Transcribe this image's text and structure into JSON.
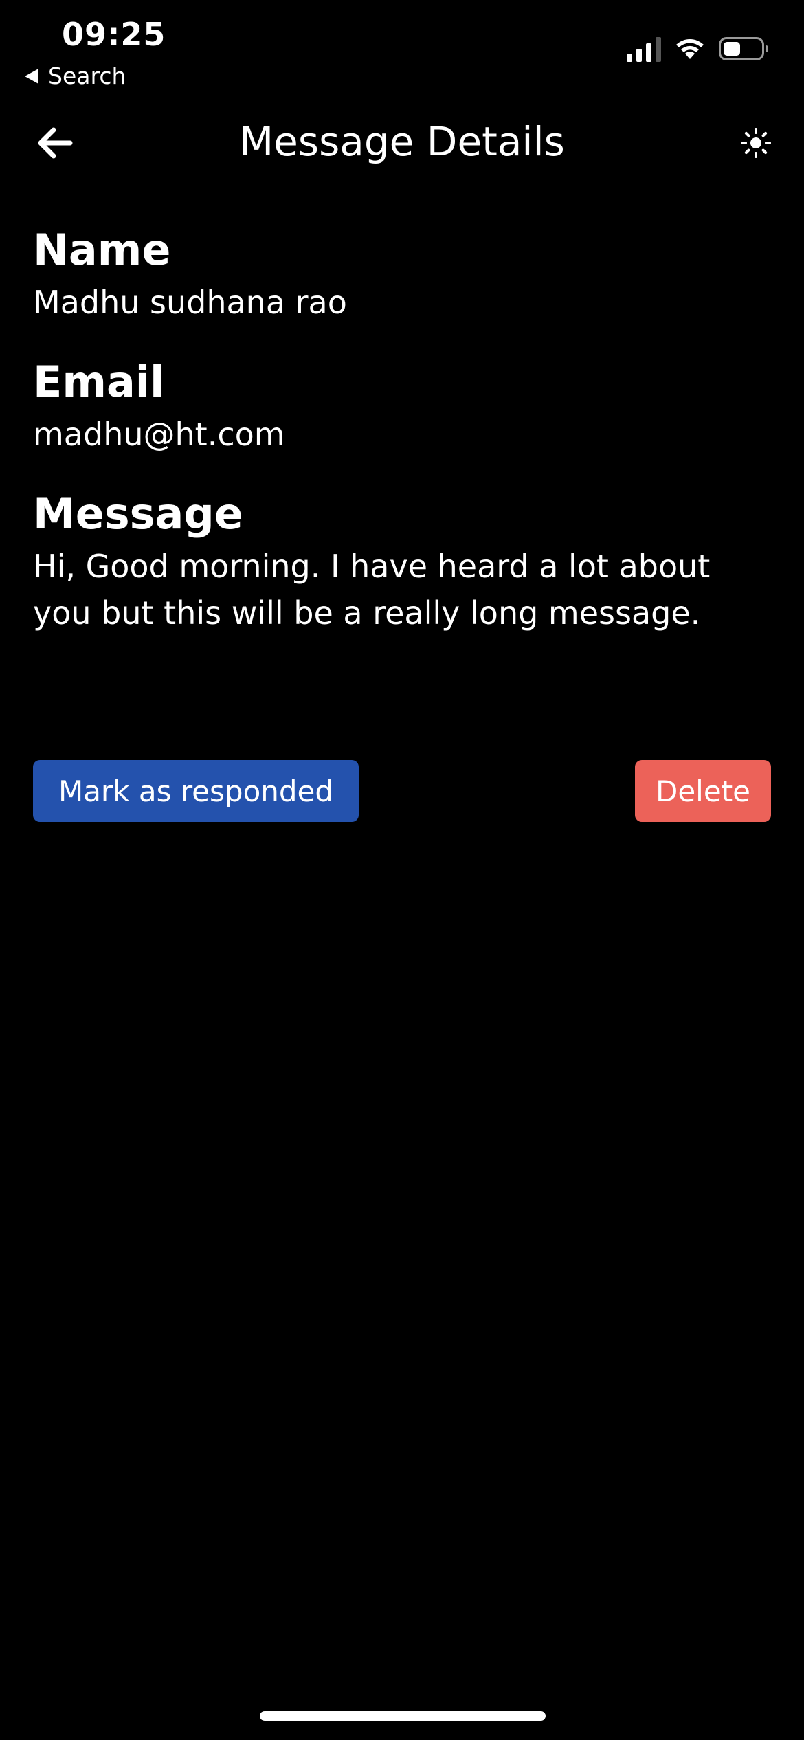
{
  "status_bar": {
    "time": "09:25",
    "back_label": "Search",
    "icons": [
      "cellular-signal-icon",
      "wifi-icon",
      "battery-icon"
    ]
  },
  "header": {
    "title": "Message Details",
    "back_icon": "arrow-left-icon",
    "theme_icon": "sun-icon"
  },
  "fields": {
    "name": {
      "label": "Name",
      "value": "Madhu sudhana rao"
    },
    "email": {
      "label": "Email",
      "value": "madhu@ht.com"
    },
    "message": {
      "label": "Message",
      "value": "Hi, Good morning. I have heard a lot about you but this will be a really long message."
    }
  },
  "actions": {
    "mark_responded_label": "Mark as responded",
    "delete_label": "Delete"
  },
  "colors": {
    "background": "#000000",
    "text": "#ffffff",
    "primary_button": "#2452ad",
    "danger_button": "#ec6259"
  }
}
